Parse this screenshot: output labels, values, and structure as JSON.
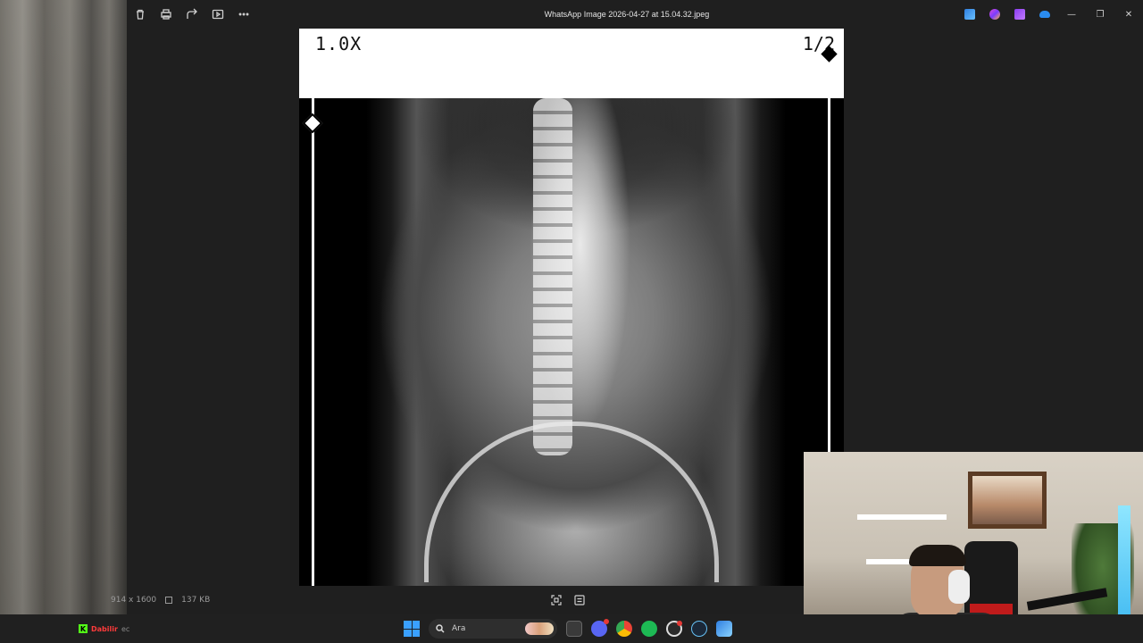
{
  "window": {
    "title": "WhatsApp Image 2026-04-27 at 15.04.32.jpeg",
    "toolbar_left": [
      "delete-icon",
      "print-icon",
      "share-icon",
      "slideshow-icon",
      "more-icon"
    ],
    "toolbar_right_apps": [
      "edit-app-icon",
      "copilot-icon",
      "clipchamp-icon",
      "onedrive-icon"
    ],
    "controls": {
      "minimize": "—",
      "maximize": "❐",
      "close": "✕"
    }
  },
  "image": {
    "zoom_label": "1.0X",
    "page_label": "1/2"
  },
  "status": {
    "dimensions": "914 x 1600",
    "file_size": "137 KB"
  },
  "taskbar": {
    "tray_label": "Dabilir",
    "tray_sub": "ec",
    "search_placeholder": "Ara",
    "apps": [
      "file-explorer-icon",
      "discord-icon",
      "chrome-icon",
      "spotify-icon",
      "obs-icon",
      "steam-icon",
      "photos-icon"
    ]
  }
}
